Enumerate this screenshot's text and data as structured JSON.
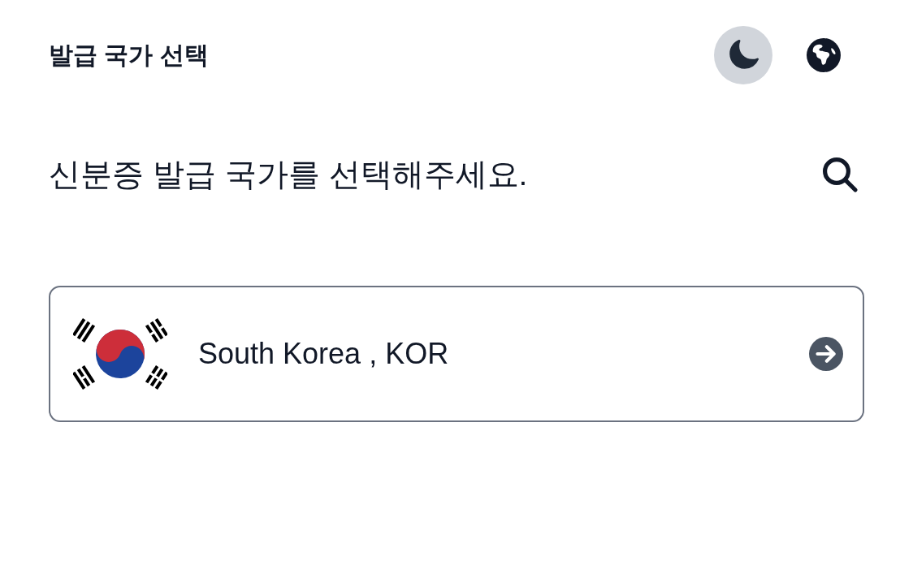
{
  "header": {
    "title": "발급 국가 선택"
  },
  "prompt": {
    "text": "신분증 발급 국가를 선택해주세요."
  },
  "countries": [
    {
      "label": "South Korea , KOR"
    }
  ]
}
